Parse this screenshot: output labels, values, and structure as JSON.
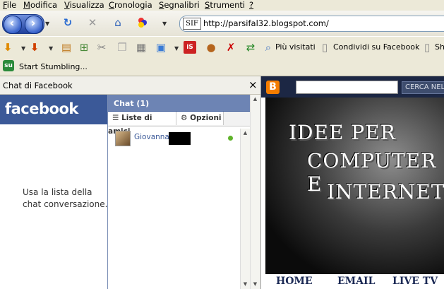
{
  "menu": [
    "File",
    "Modifica",
    "Visualizza",
    "Cronologia",
    "Segnalibri",
    "Strumenti",
    "?"
  ],
  "menu_underline": [
    "F",
    "M",
    "V",
    "C",
    "S",
    "S",
    "?"
  ],
  "menu_rest": [
    "ile",
    "odifica",
    "isualizza",
    "ronologia",
    "egnalibri",
    "trumenti",
    ""
  ],
  "nav": {
    "url": "http://parsifal32.blogspot.com/",
    "favicon_text": "SIF"
  },
  "bookmarks": {
    "piu_visitati": "Più visitati",
    "condividi": "Condividi su Facebook",
    "more": "Sh"
  },
  "stumble": {
    "label": "Start Stumbling..."
  },
  "sidebar": {
    "title": "Chat di Facebook",
    "close": "×",
    "logo": "facebook",
    "message": "Usa la lista della chat conversazione."
  },
  "chat": {
    "title": "Chat (1)",
    "tab_friends": "Liste di amici",
    "tab_options": "Opzioni",
    "friend_name": "Giovanna"
  },
  "blog": {
    "search_button": "CERCA NEL",
    "title_line1": "IDEE PER",
    "title_line2": "COMPUTER E",
    "title_line3": "INTERNET",
    "nav_items": [
      "HOME",
      "EMAIL",
      "LIVE TV"
    ]
  }
}
